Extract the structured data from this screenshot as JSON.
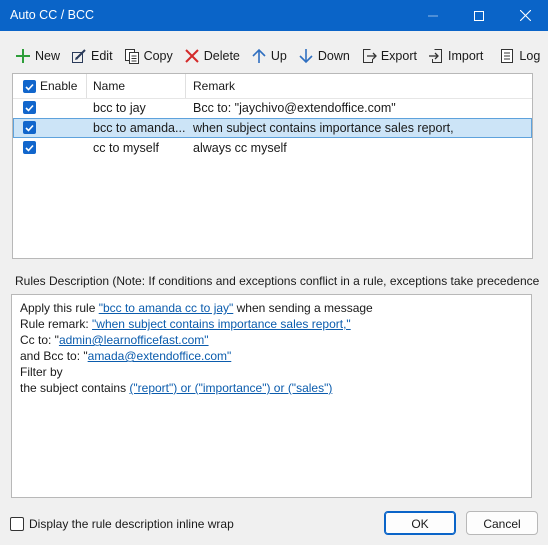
{
  "window": {
    "title": "Auto CC / BCC"
  },
  "toolbar": {
    "new": "New",
    "edit": "Edit",
    "copy": "Copy",
    "delete": "Delete",
    "up": "Up",
    "down": "Down",
    "export": "Export",
    "import": "Import",
    "log": "Log"
  },
  "list": {
    "columns": {
      "enable": "Enable",
      "name": "Name",
      "remark": "Remark"
    },
    "rows": [
      {
        "name": "bcc to jay",
        "remark": "Bcc to: \"jaychivo@extendoffice.com\"",
        "enabled": true,
        "selected": false
      },
      {
        "name": "bcc to amanda...",
        "remark": "when subject contains importance sales report,",
        "enabled": true,
        "selected": true
      },
      {
        "name": "cc to myself",
        "remark": "always cc myself",
        "enabled": true,
        "selected": false
      }
    ]
  },
  "rules": {
    "label": "Rules Description (Note: If conditions and exceptions conflict in a rule, exceptions take precedence",
    "line1_prefix": "Apply this rule ",
    "line1_link": "\"bcc to amanda cc to jay\"",
    "line1_suffix": " when sending a message",
    "line2_prefix": "Rule remark: ",
    "line2_link": "\"when subject contains importance sales report,\"",
    "line3_prefix": "Cc to: \"",
    "line3_link": "admin@learnofficefast.com\"",
    "line4_prefix": "and Bcc to: \"",
    "line4_link": "amada@extendoffice.com\"",
    "line5": "Filter by",
    "line6_prefix": "the subject contains ",
    "line6_link": "(\"report\") or (\"importance\") or (\"sales\")"
  },
  "footer": {
    "inline_wrap_label": "Display the rule description inline wrap",
    "ok": "OK",
    "cancel": "Cancel"
  },
  "colors": {
    "accent": "#0a64c8",
    "selection": "#cce4f7",
    "link": "#0b5cad"
  }
}
